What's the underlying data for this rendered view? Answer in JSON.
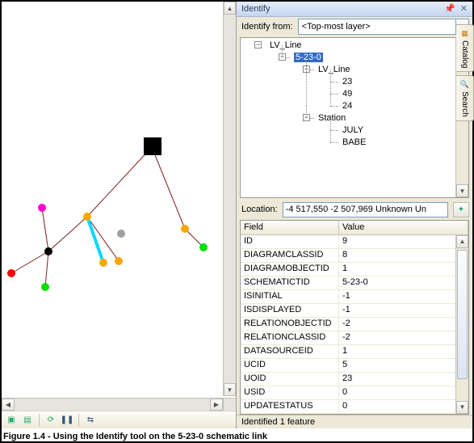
{
  "identify": {
    "title": "Identify",
    "from_label": "Identify from:",
    "from_value": "<Top-most layer>",
    "location_label": "Location:",
    "location_value": "-4 517,550 -2 507,969 Unknown Un",
    "status": "Identified 1 feature"
  },
  "tree": {
    "root": "LV_Line",
    "selected": "5-23-0",
    "child_group1": "LV_Line",
    "child_group1_items": [
      "23",
      "49",
      "24"
    ],
    "child_group2": "Station",
    "child_group2_items": [
      "JULY",
      "BABE"
    ]
  },
  "table": {
    "head_field": "Field",
    "head_value": "Value",
    "rows": [
      {
        "f": "ID",
        "v": "9"
      },
      {
        "f": "DIAGRAMCLASSID",
        "v": "8"
      },
      {
        "f": "DIAGRAMOBJECTID",
        "v": "1"
      },
      {
        "f": "SCHEMATICTID",
        "v": "5-23-0"
      },
      {
        "f": "ISINITIAL",
        "v": "-1"
      },
      {
        "f": "ISDISPLAYED",
        "v": "-1"
      },
      {
        "f": "RELATIONOBJECTID",
        "v": "-2"
      },
      {
        "f": "RELATIONCLASSID",
        "v": "-2"
      },
      {
        "f": "DATASOURCEID",
        "v": "1"
      },
      {
        "f": "UCID",
        "v": "5"
      },
      {
        "f": "UOID",
        "v": "23"
      },
      {
        "f": "USID",
        "v": "0"
      },
      {
        "f": "UPDATESTATUS",
        "v": "0"
      }
    ]
  },
  "tabs": {
    "catalog": "Catalog",
    "search": "Search"
  },
  "caption": "Figure 1.4 - Using the Identify tool on the 5-23-0 schematic link"
}
